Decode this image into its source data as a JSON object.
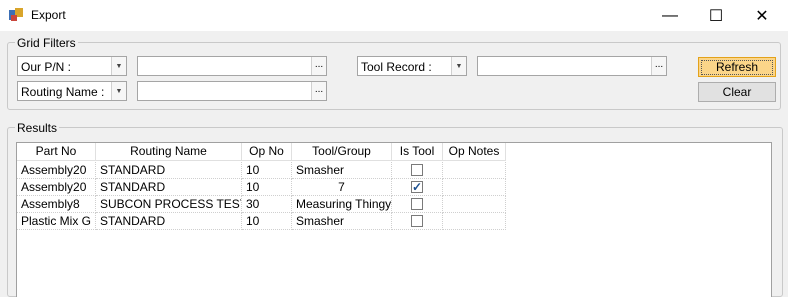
{
  "window": {
    "title": "Export"
  },
  "window_controls": {
    "minimize": "—",
    "maximize": "☐",
    "close": "✕"
  },
  "grid_filters": {
    "label": "Grid Filters",
    "field1": {
      "selected": "Our P/N :",
      "value": ""
    },
    "field2": {
      "selected": "Routing Name :",
      "value": ""
    },
    "field3": {
      "selected": "Tool Record :",
      "value": ""
    },
    "ellipsis": "..."
  },
  "buttons": {
    "refresh": "Refresh",
    "clear": "Clear"
  },
  "results": {
    "label": "Results",
    "columns": [
      "Part No",
      "Routing Name",
      "Op No",
      "Tool/Group",
      "Is Tool",
      "Op Notes"
    ],
    "rows": [
      {
        "part_no": "Assembly20",
        "routing_name": "STANDARD",
        "op_no": "10",
        "tool_group": "Smasher",
        "is_tool": false,
        "op_notes": ""
      },
      {
        "part_no": "Assembly20",
        "routing_name": "STANDARD",
        "op_no": "10",
        "tool_group": "7",
        "is_tool": true,
        "op_notes": ""
      },
      {
        "part_no": "Assembly8",
        "routing_name": "SUBCON PROCESS TEST",
        "op_no": "30",
        "tool_group": "Measuring Thingy",
        "is_tool": false,
        "op_notes": ""
      },
      {
        "part_no": "Plastic Mix G",
        "routing_name": "STANDARD",
        "op_no": "10",
        "tool_group": "Smasher",
        "is_tool": false,
        "op_notes": ""
      }
    ]
  }
}
